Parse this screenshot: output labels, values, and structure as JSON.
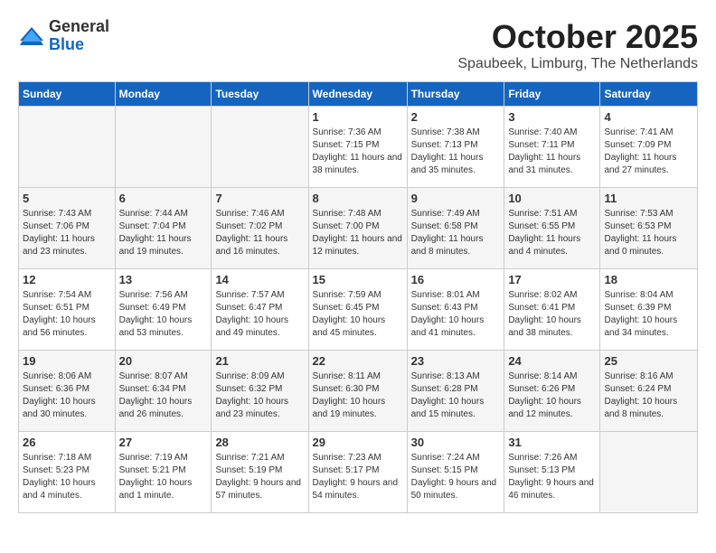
{
  "header": {
    "logo_general": "General",
    "logo_blue": "Blue",
    "month_title": "October 2025",
    "subtitle": "Spaubeek, Limburg, The Netherlands"
  },
  "days_of_week": [
    "Sunday",
    "Monday",
    "Tuesday",
    "Wednesday",
    "Thursday",
    "Friday",
    "Saturday"
  ],
  "weeks": [
    [
      {
        "day": "",
        "info": ""
      },
      {
        "day": "",
        "info": ""
      },
      {
        "day": "",
        "info": ""
      },
      {
        "day": "1",
        "info": "Sunrise: 7:36 AM\nSunset: 7:15 PM\nDaylight: 11 hours and 38 minutes."
      },
      {
        "day": "2",
        "info": "Sunrise: 7:38 AM\nSunset: 7:13 PM\nDaylight: 11 hours and 35 minutes."
      },
      {
        "day": "3",
        "info": "Sunrise: 7:40 AM\nSunset: 7:11 PM\nDaylight: 11 hours and 31 minutes."
      },
      {
        "day": "4",
        "info": "Sunrise: 7:41 AM\nSunset: 7:09 PM\nDaylight: 11 hours and 27 minutes."
      }
    ],
    [
      {
        "day": "5",
        "info": "Sunrise: 7:43 AM\nSunset: 7:06 PM\nDaylight: 11 hours and 23 minutes."
      },
      {
        "day": "6",
        "info": "Sunrise: 7:44 AM\nSunset: 7:04 PM\nDaylight: 11 hours and 19 minutes."
      },
      {
        "day": "7",
        "info": "Sunrise: 7:46 AM\nSunset: 7:02 PM\nDaylight: 11 hours and 16 minutes."
      },
      {
        "day": "8",
        "info": "Sunrise: 7:48 AM\nSunset: 7:00 PM\nDaylight: 11 hours and 12 minutes."
      },
      {
        "day": "9",
        "info": "Sunrise: 7:49 AM\nSunset: 6:58 PM\nDaylight: 11 hours and 8 minutes."
      },
      {
        "day": "10",
        "info": "Sunrise: 7:51 AM\nSunset: 6:55 PM\nDaylight: 11 hours and 4 minutes."
      },
      {
        "day": "11",
        "info": "Sunrise: 7:53 AM\nSunset: 6:53 PM\nDaylight: 11 hours and 0 minutes."
      }
    ],
    [
      {
        "day": "12",
        "info": "Sunrise: 7:54 AM\nSunset: 6:51 PM\nDaylight: 10 hours and 56 minutes."
      },
      {
        "day": "13",
        "info": "Sunrise: 7:56 AM\nSunset: 6:49 PM\nDaylight: 10 hours and 53 minutes."
      },
      {
        "day": "14",
        "info": "Sunrise: 7:57 AM\nSunset: 6:47 PM\nDaylight: 10 hours and 49 minutes."
      },
      {
        "day": "15",
        "info": "Sunrise: 7:59 AM\nSunset: 6:45 PM\nDaylight: 10 hours and 45 minutes."
      },
      {
        "day": "16",
        "info": "Sunrise: 8:01 AM\nSunset: 6:43 PM\nDaylight: 10 hours and 41 minutes."
      },
      {
        "day": "17",
        "info": "Sunrise: 8:02 AM\nSunset: 6:41 PM\nDaylight: 10 hours and 38 minutes."
      },
      {
        "day": "18",
        "info": "Sunrise: 8:04 AM\nSunset: 6:39 PM\nDaylight: 10 hours and 34 minutes."
      }
    ],
    [
      {
        "day": "19",
        "info": "Sunrise: 8:06 AM\nSunset: 6:36 PM\nDaylight: 10 hours and 30 minutes."
      },
      {
        "day": "20",
        "info": "Sunrise: 8:07 AM\nSunset: 6:34 PM\nDaylight: 10 hours and 26 minutes."
      },
      {
        "day": "21",
        "info": "Sunrise: 8:09 AM\nSunset: 6:32 PM\nDaylight: 10 hours and 23 minutes."
      },
      {
        "day": "22",
        "info": "Sunrise: 8:11 AM\nSunset: 6:30 PM\nDaylight: 10 hours and 19 minutes."
      },
      {
        "day": "23",
        "info": "Sunrise: 8:13 AM\nSunset: 6:28 PM\nDaylight: 10 hours and 15 minutes."
      },
      {
        "day": "24",
        "info": "Sunrise: 8:14 AM\nSunset: 6:26 PM\nDaylight: 10 hours and 12 minutes."
      },
      {
        "day": "25",
        "info": "Sunrise: 8:16 AM\nSunset: 6:24 PM\nDaylight: 10 hours and 8 minutes."
      }
    ],
    [
      {
        "day": "26",
        "info": "Sunrise: 7:18 AM\nSunset: 5:23 PM\nDaylight: 10 hours and 4 minutes."
      },
      {
        "day": "27",
        "info": "Sunrise: 7:19 AM\nSunset: 5:21 PM\nDaylight: 10 hours and 1 minute."
      },
      {
        "day": "28",
        "info": "Sunrise: 7:21 AM\nSunset: 5:19 PM\nDaylight: 9 hours and 57 minutes."
      },
      {
        "day": "29",
        "info": "Sunrise: 7:23 AM\nSunset: 5:17 PM\nDaylight: 9 hours and 54 minutes."
      },
      {
        "day": "30",
        "info": "Sunrise: 7:24 AM\nSunset: 5:15 PM\nDaylight: 9 hours and 50 minutes."
      },
      {
        "day": "31",
        "info": "Sunrise: 7:26 AM\nSunset: 5:13 PM\nDaylight: 9 hours and 46 minutes."
      },
      {
        "day": "",
        "info": ""
      }
    ]
  ]
}
